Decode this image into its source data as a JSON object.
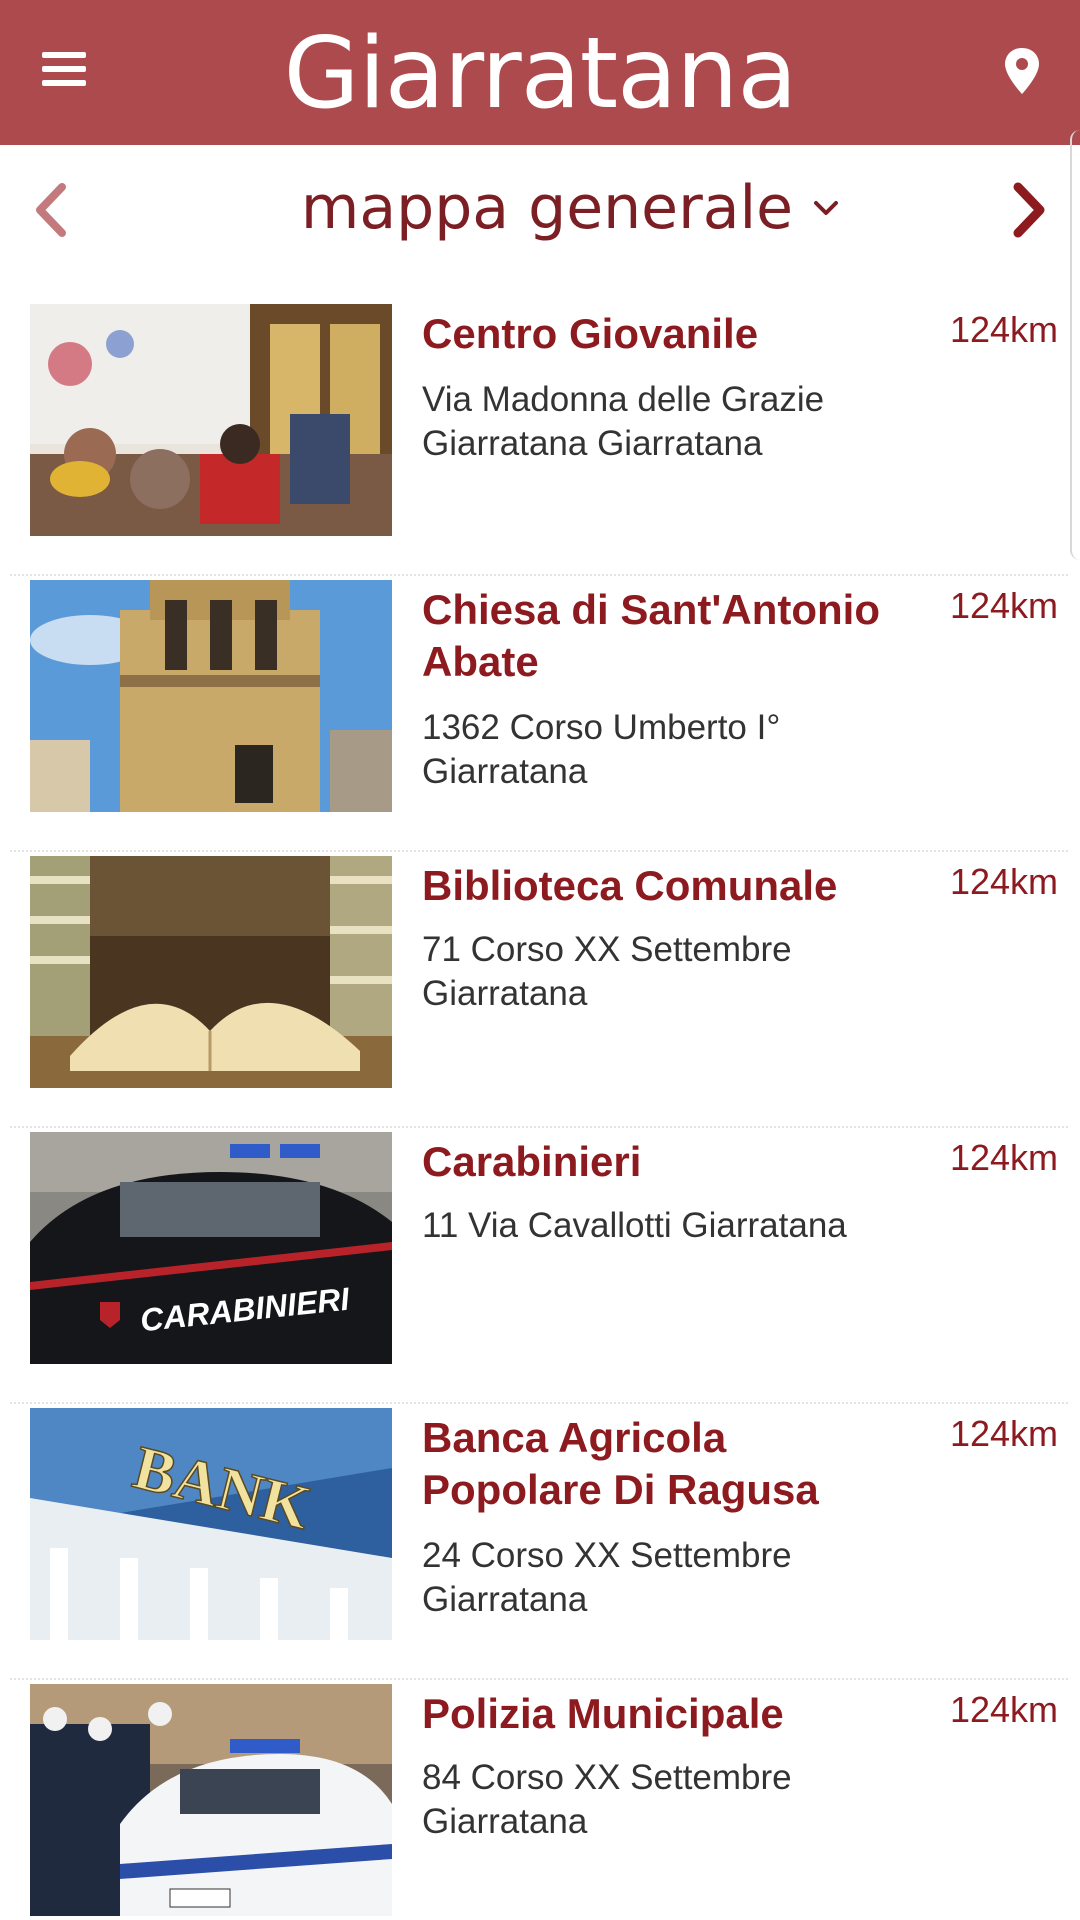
{
  "app": {
    "title": "Giarratana",
    "accent_color": "#ac4a4d",
    "text_accent_color": "#8c1a1f",
    "menu_icon": "hamburger-menu-icon",
    "location_icon": "map-pin-icon"
  },
  "selector": {
    "label": "mappa generale",
    "prev_icon": "chevron-left-icon",
    "next_icon": "chevron-right-icon",
    "dropdown_icon": "chevron-down-icon"
  },
  "places": [
    {
      "name": "Centro Giovanile",
      "distance": "124km",
      "address_line1": "Via Madonna delle Grazie",
      "address_line2": "Giarratana Giarratana"
    },
    {
      "name": "Chiesa di Sant'Antonio Abate",
      "distance": "124km",
      "address_line1": "1362 Corso Umberto I°",
      "address_line2": "Giarratana"
    },
    {
      "name": "Biblioteca Comunale",
      "distance": "124km",
      "address_line1": "71 Corso XX Settembre",
      "address_line2": "Giarratana"
    },
    {
      "name": "Carabinieri",
      "distance": "124km",
      "address_line1": "11 Via Cavallotti Giarratana",
      "address_line2": ""
    },
    {
      "name": "Banca Agricola Popolare Di Ragusa",
      "distance": "124km",
      "address_line1": "24 Corso XX Settembre",
      "address_line2": "Giarratana"
    },
    {
      "name": "Polizia Municipale",
      "distance": "124km",
      "address_line1": "84 Corso XX Settembre",
      "address_line2": "Giarratana"
    }
  ],
  "thumbnail_text": {
    "carabinieri": "CARABINIERI",
    "bank": "BANK"
  }
}
